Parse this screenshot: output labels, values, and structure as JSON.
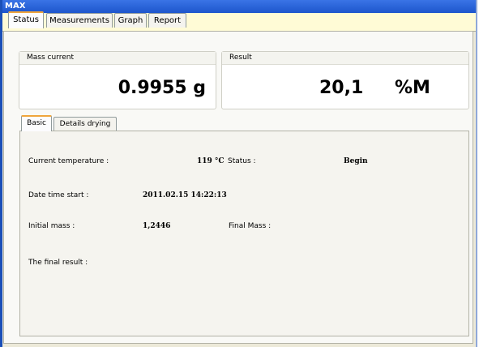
{
  "window": {
    "title": "MAX"
  },
  "tabs": [
    "Status",
    "Measurements",
    "Graph",
    "Report"
  ],
  "mass_current": {
    "header": "Mass current",
    "value": "0.9955 g"
  },
  "result": {
    "header": "Result",
    "value": "20,1",
    "unit": "%M"
  },
  "subtabs": [
    "Basic",
    "Details drying"
  ],
  "basic": {
    "current_temperature_label": "Current temperature :",
    "current_temperature_value": "119 °C",
    "status_label": "Status :",
    "status_value": "Begin",
    "date_time_start_label": "Date time start :",
    "date_time_start_value": "2011.02.15 14:22:13",
    "initial_mass_label": "Initial mass :",
    "initial_mass_value": "1,2446",
    "final_mass_label": "Final Mass :",
    "final_mass_value": "",
    "final_result_label": "The final result :",
    "final_result_value": ""
  }
}
